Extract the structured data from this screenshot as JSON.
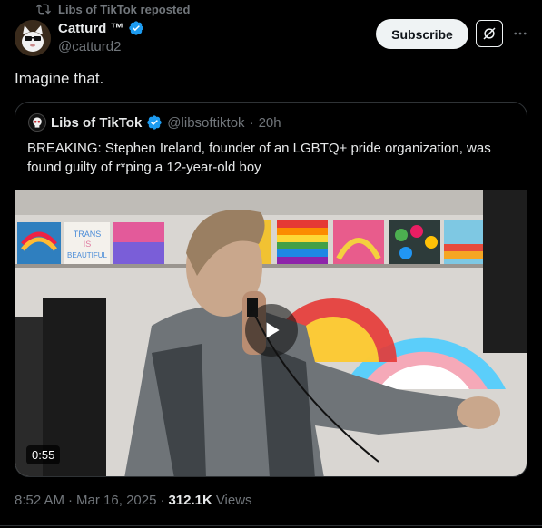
{
  "repost": {
    "label": "Libs of TikTok reposted",
    "icon": "repost-icon"
  },
  "author": {
    "name": "Catturd ™",
    "handle": "@catturd2",
    "avatar_icon": "cat-avatar"
  },
  "actions": {
    "subscribe_label": "Subscribe",
    "grok_icon": "grok-icon",
    "more_icon": "more-icon"
  },
  "tweet": {
    "text": "Imagine that."
  },
  "quote": {
    "name": "Libs of TikTok",
    "handle": "@libsoftiktok",
    "separator": "·",
    "time": "20h",
    "text": "BREAKING: Stephen Ireland, founder of an LGBTQ+ pride organization, was found guilty of r*ping a 12-year-old boy",
    "video": {
      "duration": "0:55",
      "poster_sign_lines": [
        "TRANS",
        "IS",
        "BEAUTIFUL"
      ],
      "play_icon": "play-icon"
    }
  },
  "meta": {
    "time": "8:52 AM",
    "dot1": "·",
    "date": "Mar 16, 2025",
    "dot2": "·",
    "views_count": "312.1K",
    "views_label": "Views"
  },
  "colors": {
    "background": "#000000",
    "text": "#e7e9ea",
    "muted": "#71767b",
    "verified": "#1d9bf0",
    "border": "#2f3336"
  }
}
